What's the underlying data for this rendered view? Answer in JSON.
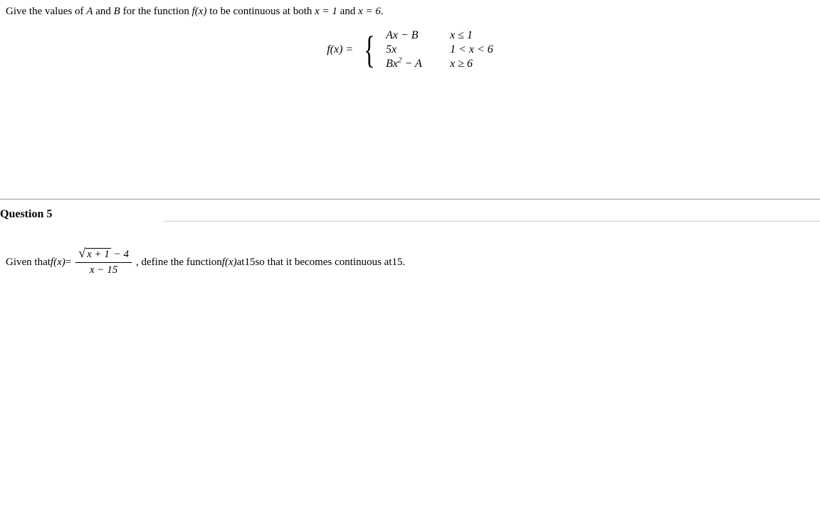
{
  "q4": {
    "prompt_prefix": "Give the values of ",
    "varA": "A",
    "prompt_and": " and ",
    "varB": "B",
    "prompt_mid": " for the function ",
    "fx": "f(x)",
    "prompt_tail1": " to be continuous at both ",
    "cond1": "x = 1",
    "prompt_tail_and": " and ",
    "cond2": "x = 6",
    "period": ".",
    "fx_eq": "f(x) = ",
    "row1_expr": "Ax − B",
    "row1_cond": "x ≤ 1",
    "row2_expr": "5x",
    "row2_cond": "1 < x < 6",
    "row3_expr_pre": "Bx",
    "row3_expr_sup": "2",
    "row3_expr_post": " − A",
    "row3_cond": "x ≥ 6"
  },
  "q5": {
    "header": "Question 5",
    "prompt_pre": "Given that ",
    "fx": "f(x)",
    "eq": " = ",
    "sqrt_arg": "x + 1",
    "num_tail": " − 4",
    "den": "x − 15",
    "prompt_mid": " , define the function ",
    "fx2": "f(x)",
    "prompt_at": " at ",
    "val": "15",
    "prompt_so": " so that it becomes continuous at ",
    "val2": "15",
    "period": "."
  }
}
